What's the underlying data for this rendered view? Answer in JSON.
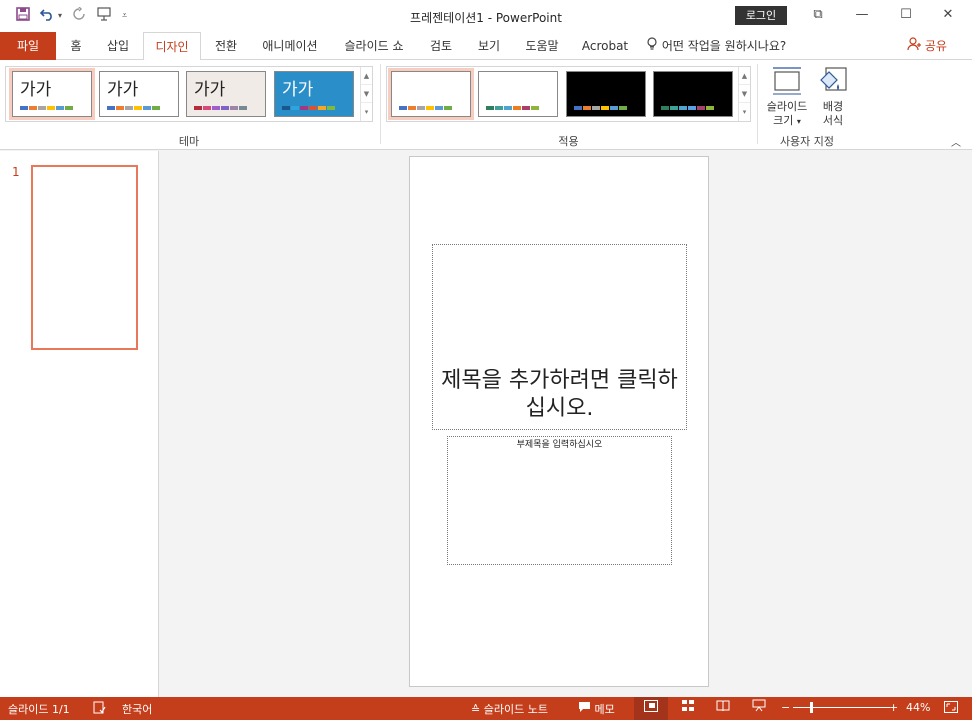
{
  "window": {
    "title": "프레젠테이션1  -  PowerPoint",
    "login_label": "로그인",
    "controls": {
      "ribbon_display": "⧉",
      "minimize": "—",
      "maximize": "☐",
      "close": "✕"
    }
  },
  "ribbon_tabs": [
    "파일",
    "홈",
    "삽입",
    "디자인",
    "전환",
    "애니메이션",
    "슬라이드 쇼",
    "검토",
    "보기",
    "도움말",
    "Acrobat"
  ],
  "active_tab": "디자인",
  "tell_me": "어떤 작업을 원하시나요?",
  "share_label": "공유",
  "themes": {
    "group_label": "테마",
    "items": [
      {
        "label": "가가",
        "bg": "#ffffff",
        "bars": [
          "#4472c4",
          "#ed7d31",
          "#a5a5a5",
          "#ffc000",
          "#5b9bd5",
          "#70ad47"
        ]
      },
      {
        "label": "가가",
        "bg": "#ffffff",
        "bars": [
          "#4472c4",
          "#ed7d31",
          "#a5a5a5",
          "#ffc000",
          "#5b9bd5",
          "#70ad47"
        ]
      },
      {
        "label": "가가",
        "bg": "#f1ebe7",
        "bars": [
          "#b22c3c",
          "#d9487a",
          "#9e5fcd",
          "#7e63c9",
          "#9f84aa",
          "#768a93"
        ]
      },
      {
        "label": "가가",
        "bg": "#2a8fc9",
        "bars": [
          "#1b568d",
          "#2ca4dd",
          "#9e3a82",
          "#e14f2e",
          "#f5a623",
          "#7fba3c"
        ]
      }
    ]
  },
  "variants": {
    "group_label": "적용",
    "items": [
      {
        "bg": "#ffffff",
        "bars": [
          "#4472c4",
          "#ed7d31",
          "#a5a5a5",
          "#ffc000",
          "#5b9bd5",
          "#70ad47"
        ]
      },
      {
        "bg": "#ffffff",
        "bars": [
          "#2f7f5f",
          "#3fa098",
          "#4ea3cf",
          "#ef7d1f",
          "#aa3f6b",
          "#8fb53a"
        ]
      },
      {
        "bg": "#000000",
        "bars": [
          "#4472c4",
          "#ed7d31",
          "#a5a5a5",
          "#ffc000",
          "#5b9bd5",
          "#70ad47"
        ]
      },
      {
        "bg": "#000000",
        "bars": [
          "#2f7f5f",
          "#3fa098",
          "#4ea3cf",
          "#5ba0e0",
          "#aa3f6b",
          "#8fb53a"
        ]
      }
    ]
  },
  "customize": {
    "group_label": "사용자 지정",
    "slide_size_label_1": "슬라이드",
    "slide_size_label_2": "크기",
    "background_label_1": "배경",
    "background_label_2": "서식"
  },
  "slide_panel": {
    "slide_number": "1"
  },
  "slide": {
    "title_placeholder": "제목을 추가하려면 클릭하십시오.",
    "subtitle_placeholder": "부제목을 입력하십시오"
  },
  "status": {
    "slide_info": "슬라이드 1/1",
    "language": "한국어",
    "notes_label": "슬라이드 노트",
    "comments_label": "메모",
    "zoom_percent": "44%",
    "zoom_minus": "−",
    "zoom_plus": "+",
    "zoom_level": 0.44
  },
  "colors": {
    "accent": "#c43e1c",
    "selection_outline": "#e9785a"
  }
}
